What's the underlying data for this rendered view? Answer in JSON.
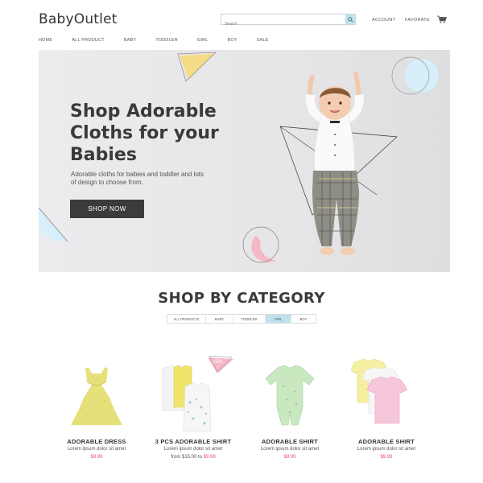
{
  "header": {
    "logo_part1": "Baby",
    "logo_part2": "Outlet",
    "search_placeholder": "Search",
    "account": "ACCOUNT",
    "favorate": "FAVORATE"
  },
  "nav": [
    "HOME",
    "ALL PRODUCT",
    "BABY",
    "TODDLER",
    "GIRL",
    "BOY",
    "SALE"
  ],
  "hero": {
    "title": "Shop Adorable\nCloths for your\nBabies",
    "subtitle": "Adorable cloths for babies and toddler and lots of design to choose from.",
    "button": "SHOP NOW"
  },
  "category": {
    "title": "SHOP BY CATEGORY",
    "tabs": [
      "ALL PRODUCTS",
      "BABY",
      "TODDLER",
      "GIRL",
      "BOY"
    ],
    "active_tab": "GIRL"
  },
  "products": [
    {
      "name": "ADORABLE DRESS",
      "desc": "Lorem ipsum dolor sit amet",
      "price": "$9.99",
      "from": ""
    },
    {
      "name": "3 PCS ADORABLE SHIRT",
      "desc": "Lorem ipsum dolor sit amet",
      "price": "$9.99",
      "from": "from $15.00 to "
    },
    {
      "name": "ADORABLE SHIRT",
      "desc": "Lorem ipsum dolor sit amet",
      "price": "$9.99",
      "from": ""
    },
    {
      "name": "ADORABLE SHIRT",
      "desc": "Lorem ipsum dolor sit amet",
      "price": "$9.99",
      "from": ""
    }
  ],
  "badge": "15%",
  "colors": {
    "accent_pink": "#e84f7a",
    "accent_blue": "#bfe3ee",
    "dark": "#3b3b3b"
  }
}
